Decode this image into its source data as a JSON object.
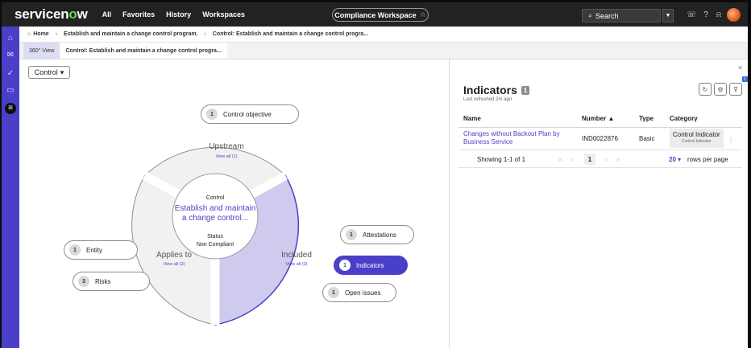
{
  "header": {
    "logo_pre": "servicen",
    "logo_o": "o",
    "logo_post": "w",
    "nav": [
      "All",
      "Favorites",
      "History",
      "Workspaces"
    ],
    "workspace": "Compliance Workspace",
    "search_placeholder": "Search"
  },
  "breadcrumb": {
    "home": "Home",
    "items": [
      "Establish and maintain a change control program.",
      "Control: Establish and maintain a change control progra..."
    ]
  },
  "tabs": [
    "360° View",
    "Control: Establish and maintain a change control progra..."
  ],
  "canvas": {
    "dropdown_label": "Control",
    "center": {
      "heading": "Control",
      "title_line1": "Establish and maintain",
      "title_line2": "a change control...",
      "status_label": "Status",
      "status_value": "Non Compliant"
    },
    "segments": {
      "upstream": {
        "label": "Upstream",
        "link": "View all (1)"
      },
      "applies": {
        "label": "Applies to",
        "link": "View all (2)"
      },
      "included": {
        "label": "Included",
        "link": "View all (3)"
      }
    },
    "pills": {
      "control_objective": {
        "count": "1",
        "label": "Control objective"
      },
      "entity": {
        "count": "1",
        "label": "Entity"
      },
      "risks": {
        "count": "3",
        "label": "Risks"
      },
      "attestations": {
        "count": "1",
        "label": "Attestations"
      },
      "indicators": {
        "count": "1",
        "label": "Indicators"
      },
      "open_issues": {
        "count": "1",
        "label": "Open issues"
      }
    }
  },
  "panel": {
    "title": "Indicators",
    "count": "1",
    "refreshed": "Last refreshed 2m ago.",
    "columns": [
      "Name",
      "Number ▲",
      "Type",
      "Category"
    ],
    "rows": [
      {
        "name_line1": "Changes without Backout Plan by",
        "name_line2": "Business Service",
        "number": "IND0022876",
        "type": "Basic",
        "category": "Control Indicator",
        "category_sub": "Control Indicator"
      }
    ],
    "showing": "Showing 1-1 of 1",
    "page": "1",
    "rows_per_page": "20 ▾",
    "rows_per_page_label": "rows per page"
  },
  "colors": {
    "accent": "#4a3fc9",
    "included_fill": "#cfcbee",
    "segment_fill": "#f1f1f1"
  }
}
